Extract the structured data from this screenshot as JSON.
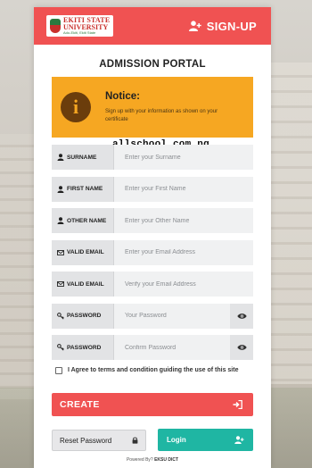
{
  "header": {
    "logo_line1": "EKITI STATE",
    "logo_line2": "UNIVERSITY",
    "logo_line3": "Ado-Ekiti, Ekiti State",
    "signup_label": "SIGN-UP"
  },
  "portal_title": "ADMISSION PORTAL",
  "notice": {
    "icon": "info-icon",
    "title": "Notice:",
    "text": "Sign up with your information as shown on your certificate"
  },
  "watermark": "allschool.com.ng",
  "fields": [
    {
      "label": "SURNAME",
      "icon": "user-icon",
      "placeholder": "Enter your Surname",
      "value": ""
    },
    {
      "label": "FIRST NAME",
      "icon": "user-icon",
      "placeholder": "Enter your First Name",
      "value": ""
    },
    {
      "label": "OTHER NAME",
      "icon": "user-icon",
      "placeholder": "Enter your Other Name",
      "value": ""
    },
    {
      "label": "VALID EMAIL",
      "icon": "envelope-icon",
      "placeholder": "Enter your Email Address",
      "value": ""
    },
    {
      "label": "VALID EMAIL",
      "icon": "envelope-icon",
      "placeholder": "Verify your Email Address",
      "value": ""
    },
    {
      "label": "PASSWORD",
      "icon": "key-icon",
      "placeholder": "Your Password",
      "value": "",
      "toggle_icon": "eye-icon"
    },
    {
      "label": "PASSWORD",
      "icon": "key-icon",
      "placeholder": "Confirm Password",
      "value": "",
      "toggle_icon": "eye-icon"
    }
  ],
  "agree_text": "I Agree to terms and condition guiding the use of this site",
  "create_label": "CREATE",
  "reset_label": "Reset Password",
  "login_label": "Login",
  "powered_prefix": "Powered By?",
  "powered_by": "EKSU DICT",
  "colors": {
    "primary_red": "#f05252",
    "notice_orange": "#f6a722",
    "login_teal": "#1fb6a3"
  }
}
